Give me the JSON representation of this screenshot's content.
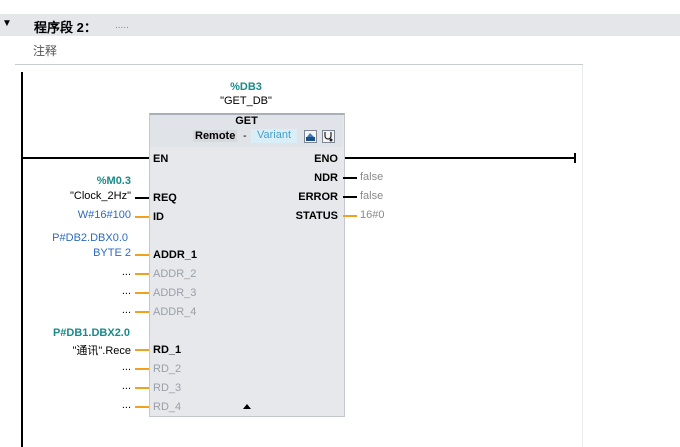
{
  "segment": {
    "title": "程序段 2：",
    "dots": ".....",
    "comment": "注释"
  },
  "block": {
    "db_address": "%DB3",
    "db_name": "\"GET_DB\"",
    "type": "GET",
    "remote_label": "Remote",
    "dash": "-",
    "variant_label": "Variant",
    "inputs": {
      "en": "EN",
      "req": "REQ",
      "id": "ID",
      "addr1": "ADDR_1",
      "addr2": "ADDR_2",
      "addr3": "ADDR_3",
      "addr4": "ADDR_4",
      "rd1": "RD_1",
      "rd2": "RD_2",
      "rd3": "RD_3",
      "rd4": "RD_4"
    },
    "outputs": {
      "eno": "ENO",
      "ndr": "NDR",
      "error": "ERROR",
      "status": "STATUS"
    }
  },
  "operands": {
    "req_addr": "%M0.3",
    "req_name": "\"Clock_2Hz\"",
    "id_value": "W#16#100",
    "addr1_ptr": "P#DB2.DBX0.0",
    "addr1_len": "BYTE 2",
    "addr2": "...",
    "addr3": "...",
    "addr4": "...",
    "rd1_ptr": "P#DB1.DBX2.0",
    "rd1_name": "\"通讯\".Rece",
    "rd2": "...",
    "rd3": "...",
    "rd4": "...",
    "ndr_value": "false",
    "error_value": "false",
    "status_value": "16#0"
  },
  "colors": {
    "header_bg": "#e4e6ea",
    "block_bg": "#e6e8ec",
    "wire_orange": "#f0a21e",
    "address_teal": "#1a8a8a",
    "constant_blue": "#2d6ac0"
  },
  "icons": [
    "collapse-triangle-icon",
    "open-block-icon",
    "stethoscope-icon",
    "expand-caret-icon"
  ]
}
